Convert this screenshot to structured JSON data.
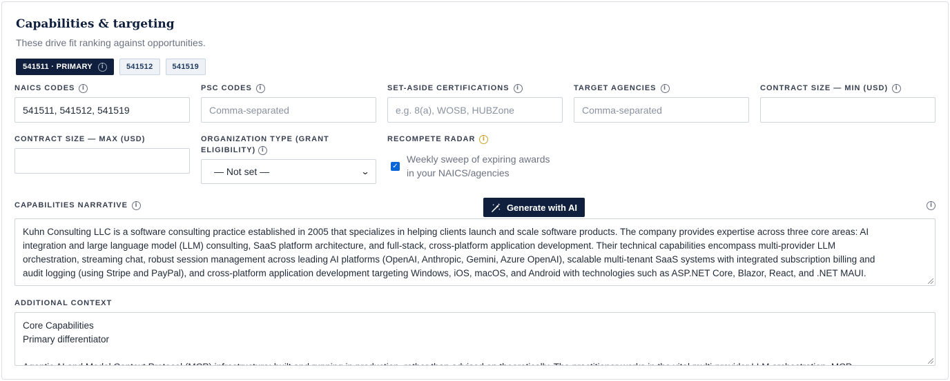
{
  "section": {
    "title": "Capabilities & targeting",
    "subtitle": "These drive fit ranking against opportunities."
  },
  "chips": [
    {
      "label": "541511 · PRIMARY",
      "primary": true
    },
    {
      "label": "541512",
      "primary": false
    },
    {
      "label": "541519",
      "primary": false
    }
  ],
  "fields": {
    "naics": {
      "label": "NAICS CODES",
      "value": "541511, 541512, 541519",
      "placeholder": ""
    },
    "psc": {
      "label": "PSC CODES",
      "value": "",
      "placeholder": "Comma-separated"
    },
    "set_aside": {
      "label": "SET-ASIDE CERTIFICATIONS",
      "value": "",
      "placeholder": "e.g. 8(a), WOSB, HUBZone"
    },
    "agencies": {
      "label": "TARGET AGENCIES",
      "value": "",
      "placeholder": "Comma-separated"
    },
    "contract_min": {
      "label": "CONTRACT SIZE — MIN (USD)",
      "value": ""
    },
    "contract_max": {
      "label": "CONTRACT SIZE — MAX (USD)",
      "value": ""
    },
    "org_type": {
      "label_line1": "ORGANIZATION TYPE (GRANT",
      "label_line2": "ELIGIBILITY)",
      "selected": "— Not set —"
    },
    "recompete": {
      "label": "RECOMPETE RADAR",
      "checked": true,
      "text_line1": "Weekly sweep of expiring awards",
      "text_line2": "in your NAICS/agencies"
    }
  },
  "narrative": {
    "label": "CAPABILITIES NARRATIVE",
    "generate_label": "Generate with AI",
    "lines": [
      "Kuhn Consulting LLC is a software consulting practice established in 2005 that specializes in helping clients launch and scale software products. The company provides expertise across three core areas: AI",
      "integration and large language model (LLM) consulting, SaaS platform architecture, and full-stack, cross-platform application development. Their technical capabilities encompass multi-provider LLM",
      "orchestration, streaming chat, robust session management across leading AI platforms (OpenAI, Anthropic, Gemini, Azure OpenAI), scalable multi-tenant SaaS systems with integrated subscription billing and",
      "audit logging (using Stripe and PayPal), and cross-platform application development targeting Windows, iOS, macOS, and Android with technologies such as ASP.NET Core, Blazor, React, and .NET MAUI."
    ]
  },
  "additional": {
    "label": "ADDITIONAL CONTEXT",
    "lines": [
      "Core Capabilities",
      "Primary differentiator",
      "",
      "Agentic AI and Model Context Protocol (MCP) infrastructure: built and running in production, rather than advised on theoretically. The practitioner works in the vital multi-provider LLM orchestration, MCP"
    ]
  },
  "icons": {
    "info": "info-icon",
    "wand": "magic-wand-icon",
    "chevron": "chevron-down-icon",
    "check": "check-icon"
  },
  "colors": {
    "navy": "#0f1f3d",
    "checkbox": "#0a66d6",
    "gold": "#c9a227"
  }
}
